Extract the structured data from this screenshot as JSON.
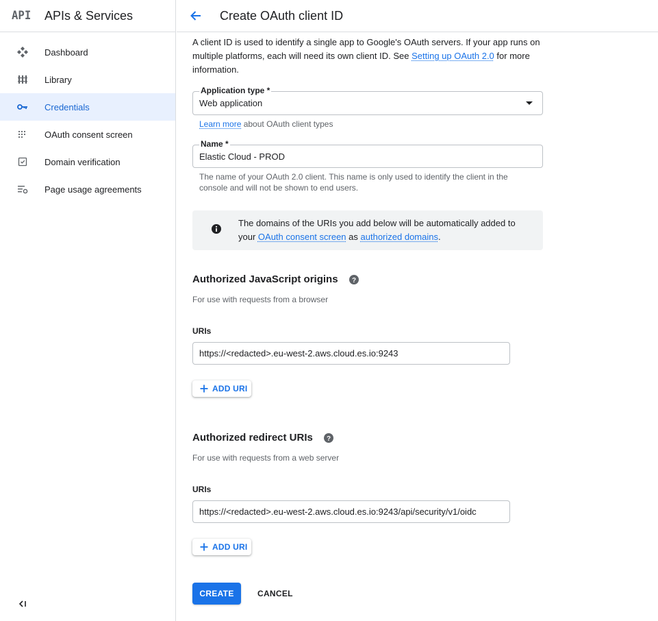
{
  "sidebar": {
    "logo_text": "API",
    "product_title": "APIs & Services",
    "items": [
      {
        "label": "Dashboard",
        "icon": "dashboard-icon"
      },
      {
        "label": "Library",
        "icon": "library-icon"
      },
      {
        "label": "Credentials",
        "icon": "key-icon"
      },
      {
        "label": "OAuth consent screen",
        "icon": "consent-icon"
      },
      {
        "label": "Domain verification",
        "icon": "checkbox-icon"
      },
      {
        "label": "Page usage agreements",
        "icon": "settings-list-icon"
      }
    ],
    "active_item": "Credentials",
    "collapse_icon": "collapse-sidebar-icon"
  },
  "header": {
    "title": "Create OAuth client ID",
    "back_icon": "arrow-back-icon"
  },
  "intro": {
    "text_before": "A client ID is used to identify a single app to Google's OAuth servers. If your app runs on multiple platforms, each will need its own client ID. See ",
    "link": "Setting up OAuth 2.0",
    "text_after": " for more information."
  },
  "application_type": {
    "label": "Application type *",
    "value": "Web application",
    "learn_more_link": "Learn more",
    "learn_more_suffix": " about OAuth client types"
  },
  "name_field": {
    "label": "Name *",
    "value": "Elastic Cloud - PROD",
    "helper": "The name of your OAuth 2.0 client. This name is only used to identify the client in the console and will not be shown to end users."
  },
  "info_box": {
    "text_before": "The domains of the URIs you add below will be automatically added to your ",
    "link1": "OAuth consent screen",
    "text_middle": " as ",
    "link2": "authorized domains",
    "text_after": "."
  },
  "js_origins": {
    "title": "Authorized JavaScript origins",
    "subtitle": "For use with requests from a browser",
    "uris_label": "URIs",
    "uri_value": "https://<redacted>.eu-west-2.aws.cloud.es.io:9243",
    "add_label": "ADD URI"
  },
  "redirect_uris": {
    "title": "Authorized redirect URIs",
    "subtitle": "For use with requests from a web server",
    "uris_label": "URIs",
    "uri_value": "https://<redacted>.eu-west-2.aws.cloud.es.io:9243/api/security/v1/oidc",
    "add_label": "ADD URI"
  },
  "actions": {
    "create_label": "CREATE",
    "cancel_label": "CANCEL"
  },
  "colors": {
    "accent": "#1a73e8",
    "active_bg": "#e8f0fe",
    "info_bg": "#f1f3f4",
    "border": "#dadce0"
  }
}
